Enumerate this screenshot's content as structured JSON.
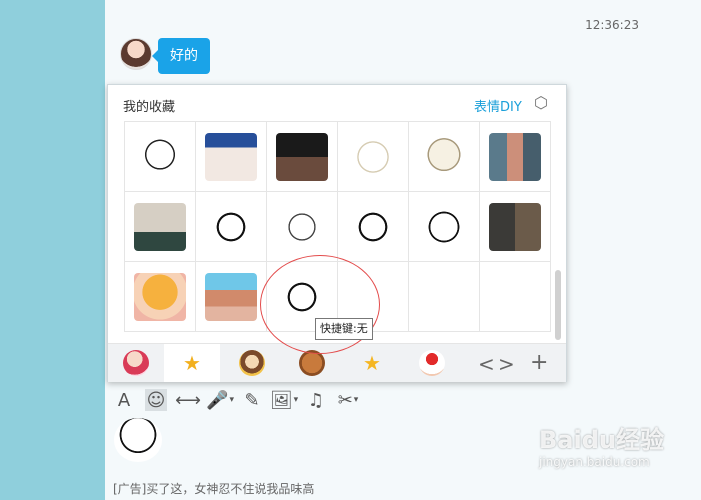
{
  "chat": {
    "timestamp": "12:36:23",
    "message": "好的",
    "ad_text": "[广告]买了这，女神忍不住说我品味高"
  },
  "panel": {
    "title": "我的收藏",
    "diy_label": "表情DIY",
    "tooltip": "快捷键:无",
    "settings_icon": "hexagon-settings-icon",
    "nav_left": "<",
    "nav_right": ">",
    "add_label": "+"
  },
  "toolbar": {
    "font_icon": "A",
    "emoji_icon": "☺",
    "shake_icon": "⟷",
    "mic_icon": "🎤",
    "pen_icon": "✎",
    "image_icon": "🖼",
    "music_icon": "♫",
    "scissors_icon": "✂"
  },
  "watermark": {
    "brand": "Baidu经验",
    "url": "jingyan.baidu.com"
  },
  "colors": {
    "accent": "#1a9fd9",
    "bubble": "#1aa3e8",
    "left_strip": "#8fcfdc",
    "circle": "#e34b4b"
  }
}
